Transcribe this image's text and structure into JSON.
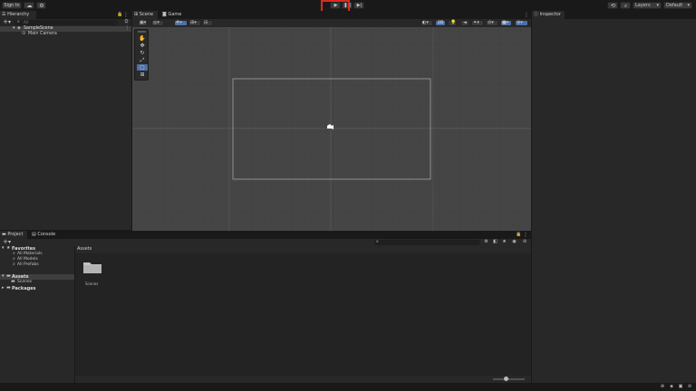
{
  "toolbar": {
    "sign_in_label": "Sign In",
    "layers_label": "Layers",
    "layout_label": "Default"
  },
  "hierarchy": {
    "tab_label": "Hierarchy",
    "search_placeholder": "All",
    "scene_name": "SampleScene",
    "items": [
      {
        "label": "Main Camera"
      }
    ]
  },
  "scene_view": {
    "tabs": [
      {
        "label": "Scene"
      },
      {
        "label": "Game"
      }
    ],
    "mode_2d_label": "2D"
  },
  "inspector": {
    "tab_label": "Inspector"
  },
  "project": {
    "tabs": [
      {
        "label": "Project"
      },
      {
        "label": "Console"
      }
    ],
    "tree": {
      "favorites_label": "Favorites",
      "favorites_items": [
        {
          "label": "All Materials"
        },
        {
          "label": "All Models"
        },
        {
          "label": "All Prefabs"
        }
      ],
      "assets_label": "Assets",
      "scenes_label": "Scenes",
      "packages_label": "Packages"
    },
    "breadcrumb": "Assets",
    "folders": [
      {
        "name": "Scenes"
      }
    ],
    "slider_value": 0.4
  },
  "colors": {
    "highlight": "#d92b1f",
    "accent": "#4d6fa8"
  }
}
